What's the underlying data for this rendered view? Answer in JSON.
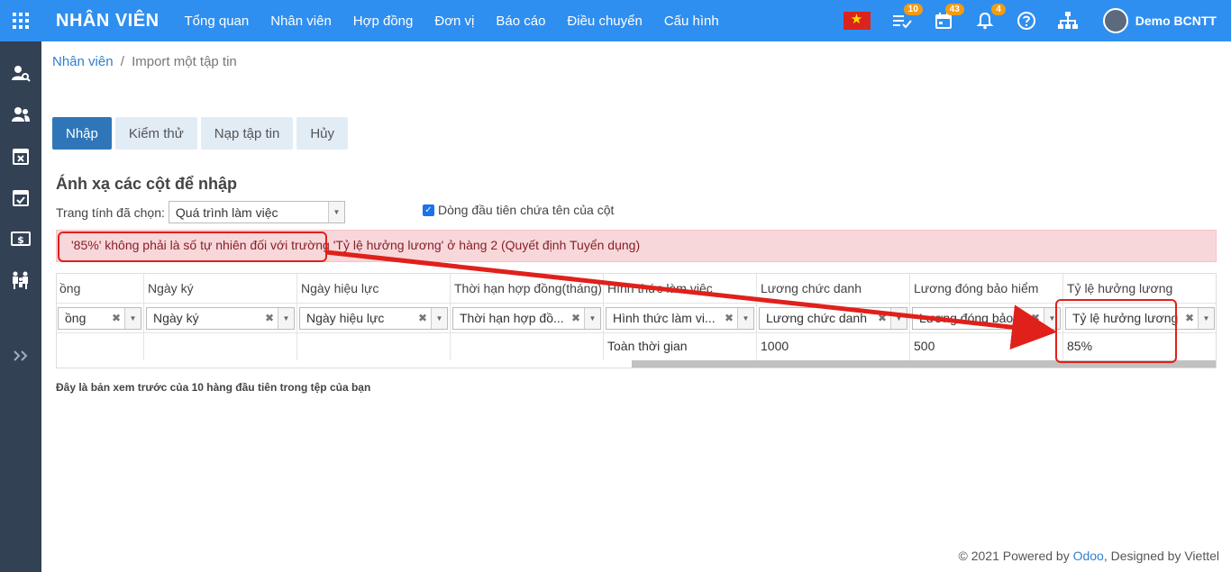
{
  "app": {
    "title": "NHÂN VIÊN",
    "menu": [
      "Tổng quan",
      "Nhân viên",
      "Hợp đồng",
      "Đơn vị",
      "Báo cáo",
      "Điều chuyển",
      "Cấu hình"
    ],
    "badges": {
      "activities": "10",
      "calendar": "43",
      "notifications": "4"
    },
    "user": "Demo BCNTT"
  },
  "breadcrumb": {
    "root": "Nhân viên",
    "separator": "/",
    "current": "Import một tập tin"
  },
  "actions": {
    "import": "Nhập",
    "test": "Kiểm thử",
    "load_file": "Nạp tập tin",
    "cancel": "Hủy"
  },
  "mapping": {
    "title": "Ánh xạ các cột để nhập",
    "sheet_label": "Trang tính đã chọn:",
    "sheet_value": "Quá trình làm việc",
    "header_checkbox_label": "Dòng đầu tiên chứa tên của cột",
    "error": "'85%' không phải là số tự nhiên đối với trường 'Tỷ lệ hưởng lương' ở hàng 2 (Quyết định Tuyển dụng)"
  },
  "columns": [
    {
      "header": "ồng",
      "field": "ồng",
      "value": ""
    },
    {
      "header": "Ngày ký",
      "field": "Ngày ký",
      "value": ""
    },
    {
      "header": "Ngày hiệu lực",
      "field": "Ngày hiệu lực",
      "value": ""
    },
    {
      "header": "Thời hạn hợp đồng(tháng)",
      "field": "Thời hạn hợp đồ...",
      "value": ""
    },
    {
      "header": "Hình thức làm việc",
      "field": "Hình thức làm vi...",
      "value": "Toàn thời gian"
    },
    {
      "header": "Lương chức danh",
      "field": "Lương chức danh",
      "value": "1000"
    },
    {
      "header": "Lương đóng bảo hiểm",
      "field": "Lương đóng bảo ...",
      "value": "500"
    },
    {
      "header": "Tỷ lệ hưởng lương",
      "field": "Tỷ lệ hưởng lương",
      "value": "85%"
    }
  ],
  "preview_note": "Đây là bản xem trước của 10 hàng đầu tiên trong tệp của bạn",
  "footer": {
    "prefix": "© 2021 Powered by ",
    "odoo": "Odoo",
    "suffix": ", Designed by Viettel"
  },
  "colors": {
    "primary": "#2f8ff0",
    "sidebar": "#334155",
    "alert_bg": "#f8d7da",
    "annotation": "#e0201b"
  }
}
